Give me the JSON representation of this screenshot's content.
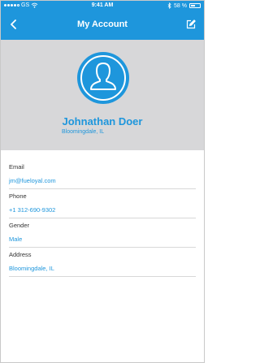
{
  "status_bar": {
    "carrier": "GS",
    "time": "9:41 AM",
    "battery": "58 %",
    "battery_level": 0.58
  },
  "nav": {
    "title": "My Account",
    "back_icon": "chevron-left-icon",
    "edit_icon": "edit-icon"
  },
  "profile": {
    "name": "Johnathan Doer",
    "location": "Bloomingdale, IL",
    "avatar_icon": "user-icon"
  },
  "fields": [
    {
      "label": "Email",
      "value": "jm@fueloyal.com"
    },
    {
      "label": "Phone",
      "value": "+1 312-690-9302"
    },
    {
      "label": "Gender",
      "value": "Male"
    },
    {
      "label": "Address",
      "value": "Bloomingdale, IL"
    }
  ],
  "colors": {
    "accent": "#1e96dc",
    "header_bg": "#d7d7d9",
    "divider": "#d8d8d8"
  }
}
